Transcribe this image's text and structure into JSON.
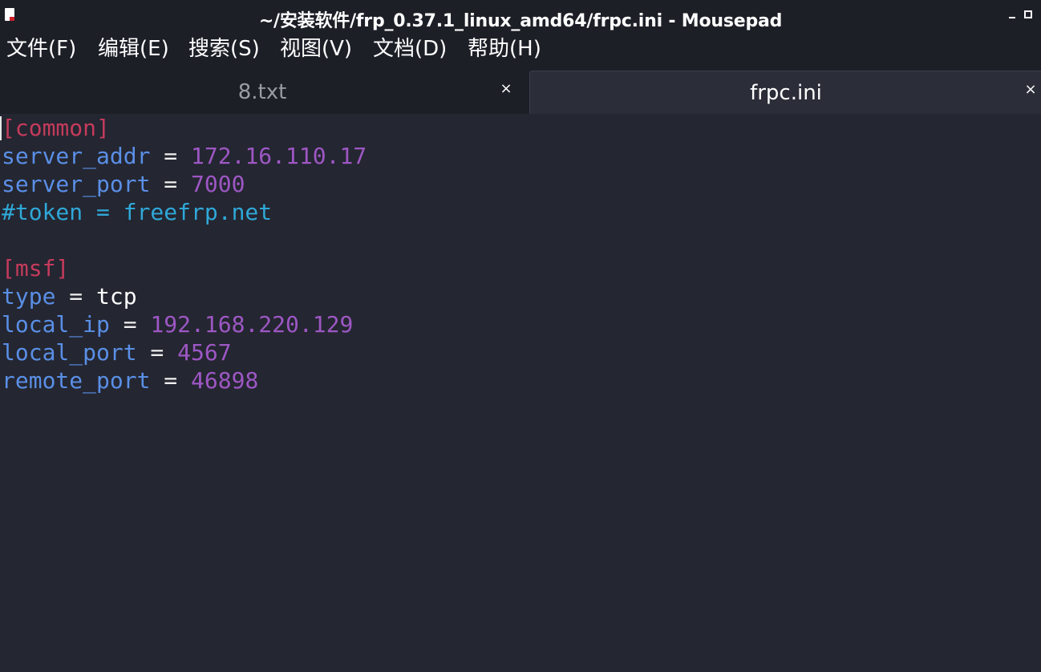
{
  "window": {
    "title": "~/安装软件/frp_0.37.1_linux_amd64/frpc.ini - Mousepad"
  },
  "menu": {
    "items": [
      "文件(F)",
      "编辑(E)",
      "搜索(S)",
      "视图(V)",
      "文档(D)",
      "帮助(H)"
    ]
  },
  "tabs": [
    {
      "label": "8.txt",
      "active": false,
      "close": "×"
    },
    {
      "label": "frpc.ini",
      "active": true,
      "close": "×"
    }
  ],
  "editor": {
    "lines": [
      [
        {
          "t": "section",
          "s": "[common]"
        }
      ],
      [
        {
          "t": "key",
          "s": "server_addr"
        },
        {
          "t": "eq",
          "s": " = "
        },
        {
          "t": "num",
          "s": "172.16.110.17"
        }
      ],
      [
        {
          "t": "key",
          "s": "server_port"
        },
        {
          "t": "eq",
          "s": " = "
        },
        {
          "t": "num",
          "s": "7000"
        }
      ],
      [
        {
          "t": "comment",
          "s": "#token = freefrp.net"
        }
      ],
      [],
      [
        {
          "t": "section",
          "s": "[msf]"
        }
      ],
      [
        {
          "t": "key",
          "s": "type"
        },
        {
          "t": "eq",
          "s": " = "
        },
        {
          "t": "plain",
          "s": "tcp"
        }
      ],
      [
        {
          "t": "key",
          "s": "local_ip"
        },
        {
          "t": "eq",
          "s": " = "
        },
        {
          "t": "num",
          "s": "192.168.220.129"
        }
      ],
      [
        {
          "t": "key",
          "s": "local_port"
        },
        {
          "t": "eq",
          "s": " = "
        },
        {
          "t": "num",
          "s": "4567"
        }
      ],
      [
        {
          "t": "key",
          "s": "remote_port"
        },
        {
          "t": "eq",
          "s": " = "
        },
        {
          "t": "num",
          "s": "46898"
        }
      ]
    ]
  },
  "colors": {
    "background": "#242631",
    "section": "#c53b5c",
    "key": "#5a8fe6",
    "number": "#9d57c4",
    "comment": "#2fa8d8"
  }
}
